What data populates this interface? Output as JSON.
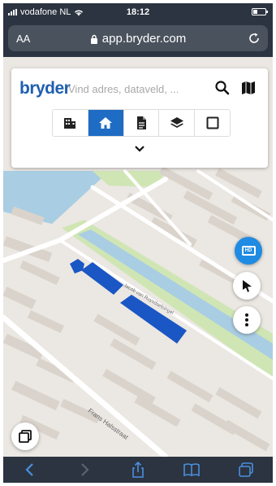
{
  "status_bar": {
    "carrier": "vodafone NL",
    "time": "18:12"
  },
  "browser": {
    "text_size_label": "AA",
    "url": "app.bryder.com"
  },
  "search_card": {
    "logo_text": "bryder",
    "search_placeholder": "Vind adres, dataveld, ...",
    "modes": [
      {
        "name": "buildings",
        "icon": "building-icon",
        "active": false
      },
      {
        "name": "home",
        "icon": "home-icon",
        "active": true
      },
      {
        "name": "document",
        "icon": "document-icon",
        "active": false
      },
      {
        "name": "layers",
        "icon": "layers-icon",
        "active": false
      },
      {
        "name": "area",
        "icon": "square-icon",
        "active": false
      }
    ]
  },
  "map": {
    "street_labels": [
      "Frans Halsstraat",
      "Jacob van Ruysdaelsingel"
    ],
    "fab_blue_label": "HD"
  },
  "colors": {
    "brand": "#1f5fb0",
    "active_mode": "#1f6cc4",
    "building_highlight": "#1a56c4",
    "location_button": "#1f8be3",
    "browser_chrome": "#2b3440",
    "toolbar_icon": "#4a8fe0"
  }
}
